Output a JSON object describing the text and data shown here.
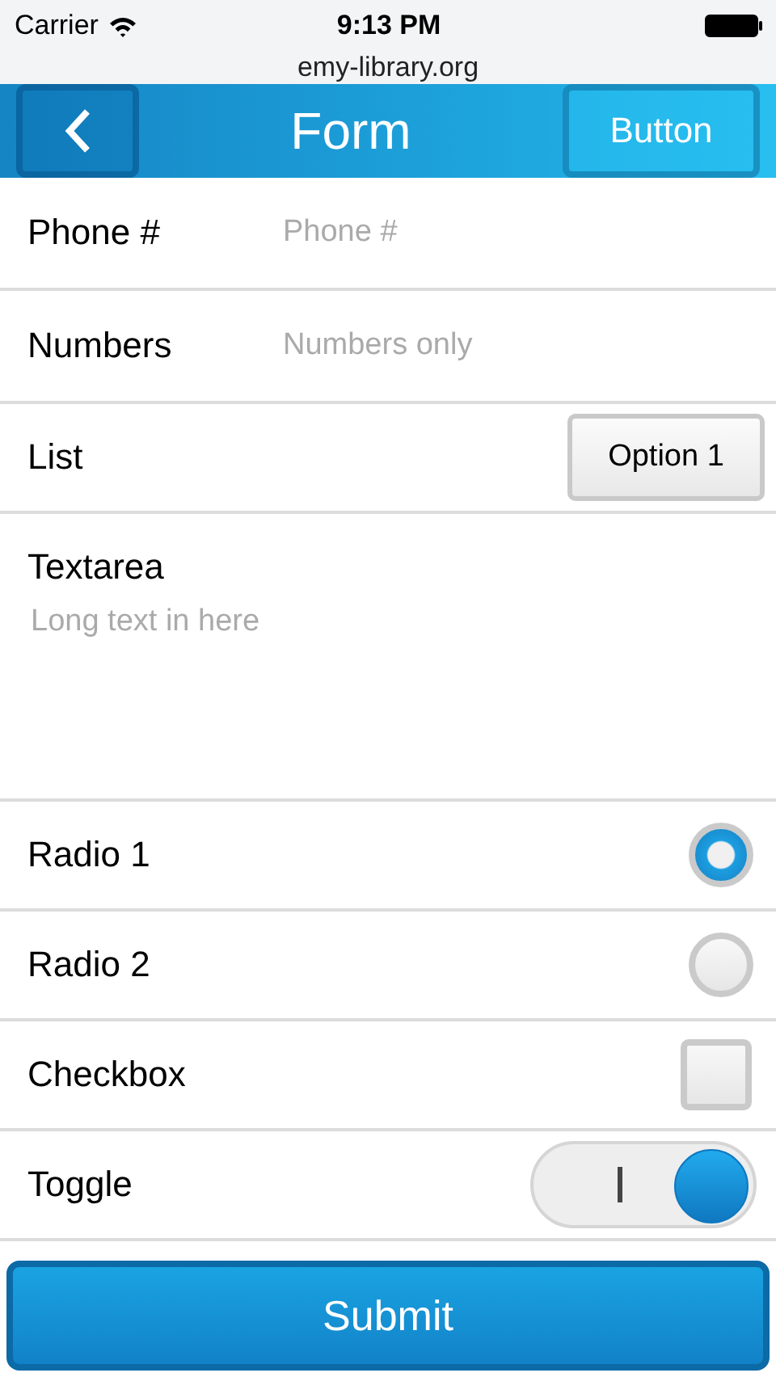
{
  "status_bar": {
    "carrier": "Carrier",
    "time": "9:13 PM"
  },
  "address_bar": {
    "url": "emy-library.org"
  },
  "nav_bar": {
    "title": "Form",
    "right_button": "Button"
  },
  "rows": [
    {
      "kind": "text",
      "label": "Phone #",
      "placeholder": "Phone #"
    },
    {
      "kind": "text",
      "label": "Numbers",
      "placeholder": "Numbers only"
    },
    {
      "kind": "select",
      "label": "List",
      "value": "Option 1"
    },
    {
      "kind": "textarea",
      "label": "Textarea",
      "placeholder": "Long text in here"
    },
    {
      "kind": "radio",
      "label": "Radio 1",
      "selected": true
    },
    {
      "kind": "radio",
      "label": "Radio 2",
      "selected": false
    },
    {
      "kind": "checkbox",
      "label": "Checkbox",
      "checked": false
    },
    {
      "kind": "toggle",
      "label": "Toggle",
      "on": true
    }
  ],
  "submit": "Submit"
}
